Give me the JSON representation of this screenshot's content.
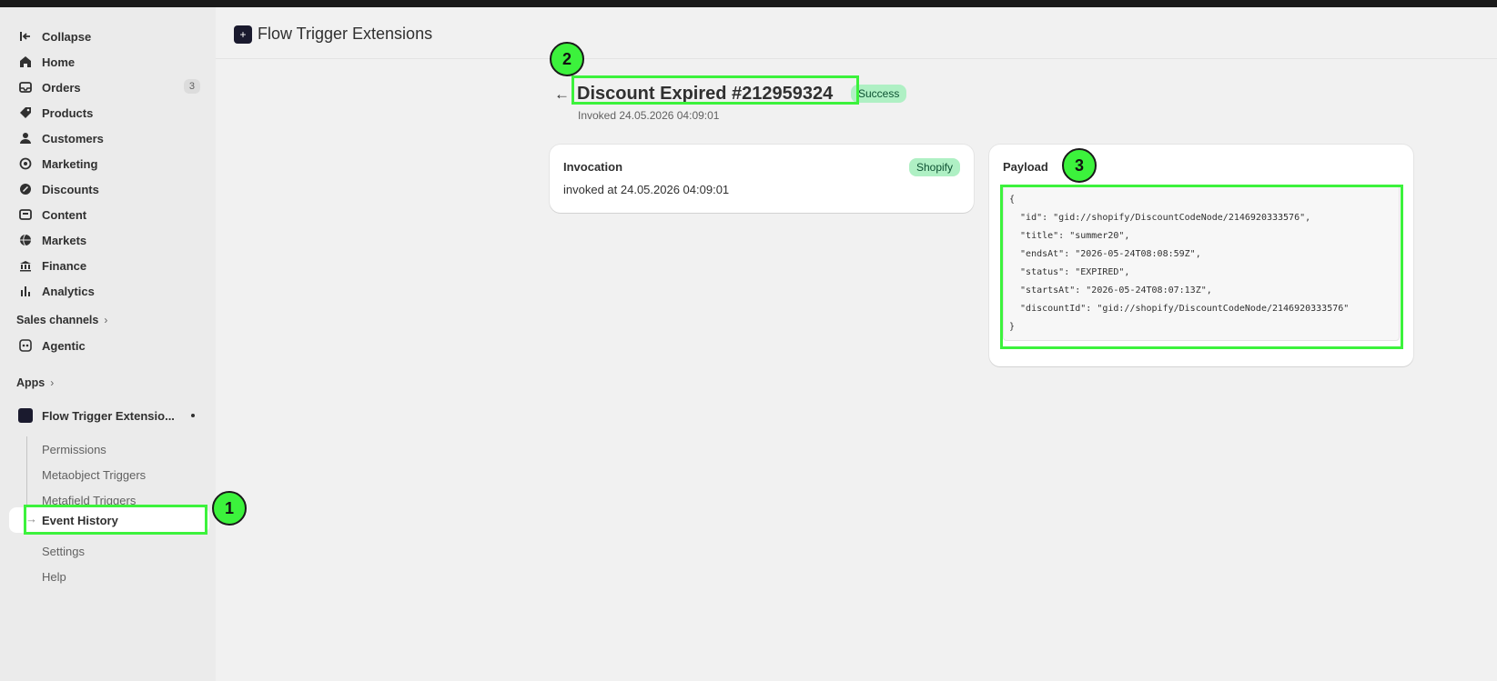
{
  "sidebar": {
    "collapse_label": "Collapse",
    "items": [
      {
        "label": "Home"
      },
      {
        "label": "Orders",
        "count": "3"
      },
      {
        "label": "Products"
      },
      {
        "label": "Customers"
      },
      {
        "label": "Marketing"
      },
      {
        "label": "Discounts"
      },
      {
        "label": "Content"
      },
      {
        "label": "Markets"
      },
      {
        "label": "Finance"
      },
      {
        "label": "Analytics"
      }
    ],
    "sales_channels_label": "Sales channels",
    "agentic_label": "Agentic",
    "apps_label": "Apps",
    "app_name": "Flow Trigger Extensio...",
    "app_subitems": [
      {
        "label": "Permissions"
      },
      {
        "label": "Metaobject Triggers"
      },
      {
        "label": "Metafield Triggers"
      },
      {
        "label": "Event History"
      },
      {
        "label": "Settings"
      },
      {
        "label": "Help"
      }
    ]
  },
  "header": {
    "title": "Flow Trigger Extensions"
  },
  "page": {
    "title": "Discount Expired #212959324",
    "status": "Success",
    "subtitle": "Invoked 24.05.2026 04:09:01"
  },
  "invocation": {
    "heading": "Invocation",
    "badge": "Shopify",
    "text": "invoked at 24.05.2026 04:09:01"
  },
  "payload": {
    "heading": "Payload",
    "code": "{\n  \"id\": \"gid://shopify/DiscountCodeNode/2146920333576\",\n  \"title\": \"summer20\",\n  \"endsAt\": \"2026-05-24T08:08:59Z\",\n  \"status\": \"EXPIRED\",\n  \"startsAt\": \"2026-05-24T08:07:13Z\",\n  \"discountId\": \"gid://shopify/DiscountCodeNode/2146920333576\"\n}"
  },
  "annotations": {
    "marker1": "1",
    "marker2": "2",
    "marker3": "3",
    "highlight_color": "#3cf23c"
  }
}
